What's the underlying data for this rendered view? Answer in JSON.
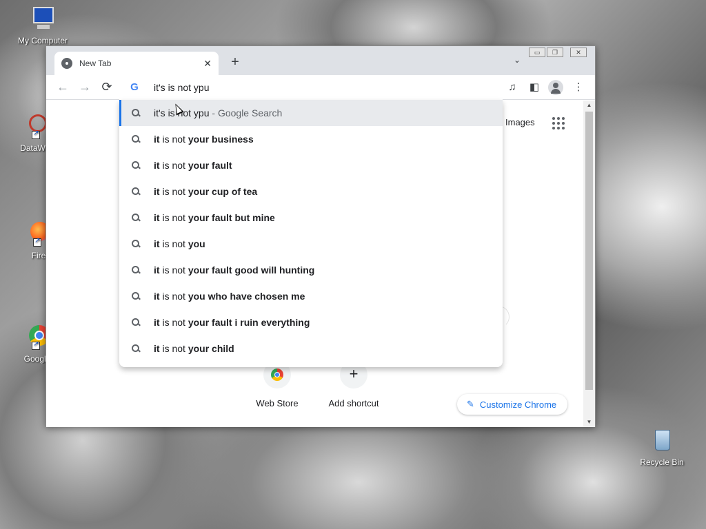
{
  "desktop": {
    "icons": [
      {
        "label": "My Computer",
        "icon": "my-computer-icon"
      },
      {
        "label": "DataWag",
        "icon": "datawag-icon"
      },
      {
        "label": "Fire",
        "icon": "firefox-icon"
      },
      {
        "label": "Google",
        "icon": "chrome-icon"
      },
      {
        "label": "Recycle Bin",
        "icon": "recycle-bin-icon"
      }
    ]
  },
  "window": {
    "controls": {
      "minimize": "▭",
      "restore": "❐",
      "close": "✕"
    }
  },
  "tab": {
    "title": "New Tab",
    "close": "✕"
  },
  "tabbar": {
    "new_tab": "+",
    "tab_list": "⌄"
  },
  "toolbar": {
    "back": "←",
    "forward": "→",
    "reload": "⟳",
    "media": "♫",
    "side_panel": "◧",
    "menu": "⋮"
  },
  "omnibox": {
    "query": "it's is not ypu",
    "engine_logo": "G",
    "suggestions": [
      {
        "parts": [
          {
            "t": "it's is not ypu",
            "b": false
          }
        ],
        "suffix": " - Google Search",
        "selected": true
      },
      {
        "parts": [
          {
            "t": "it",
            "b": true
          },
          {
            "t": " is not ",
            "b": false
          },
          {
            "t": "your business",
            "b": true
          }
        ]
      },
      {
        "parts": [
          {
            "t": "it",
            "b": true
          },
          {
            "t": " is not ",
            "b": false
          },
          {
            "t": "your fault",
            "b": true
          }
        ]
      },
      {
        "parts": [
          {
            "t": "it",
            "b": true
          },
          {
            "t": " is not ",
            "b": false
          },
          {
            "t": "your cup of tea",
            "b": true
          }
        ]
      },
      {
        "parts": [
          {
            "t": "it",
            "b": true
          },
          {
            "t": " is not ",
            "b": false
          },
          {
            "t": "your fault but mine",
            "b": true
          }
        ]
      },
      {
        "parts": [
          {
            "t": "it",
            "b": true
          },
          {
            "t": " is not ",
            "b": false
          },
          {
            "t": "you",
            "b": true
          }
        ]
      },
      {
        "parts": [
          {
            "t": "it",
            "b": true
          },
          {
            "t": " is not ",
            "b": false
          },
          {
            "t": "your fault good will hunting",
            "b": true
          }
        ]
      },
      {
        "parts": [
          {
            "t": "it",
            "b": true
          },
          {
            "t": " is not ",
            "b": false
          },
          {
            "t": "you who have chosen me",
            "b": true
          }
        ]
      },
      {
        "parts": [
          {
            "t": "it",
            "b": true
          },
          {
            "t": " is not ",
            "b": false
          },
          {
            "t": "your fault i ruin everything",
            "b": true
          }
        ]
      },
      {
        "parts": [
          {
            "t": "it",
            "b": true
          },
          {
            "t": " is not ",
            "b": false
          },
          {
            "t": "your child",
            "b": true
          }
        ]
      }
    ]
  },
  "page": {
    "images_link": "Images",
    "shortcuts": [
      {
        "label": "Web Store",
        "icon": "web-store-icon"
      },
      {
        "label": "Add shortcut",
        "icon": "plus-icon",
        "glyph": "+"
      }
    ],
    "customize": {
      "label": "Customize Chrome",
      "icon": "pencil-icon",
      "glyph": "✎"
    }
  },
  "colors": {
    "accent": "#1a73e8",
    "tabbar_bg": "#dee1e6",
    "selected_row": "#e8eaed"
  }
}
